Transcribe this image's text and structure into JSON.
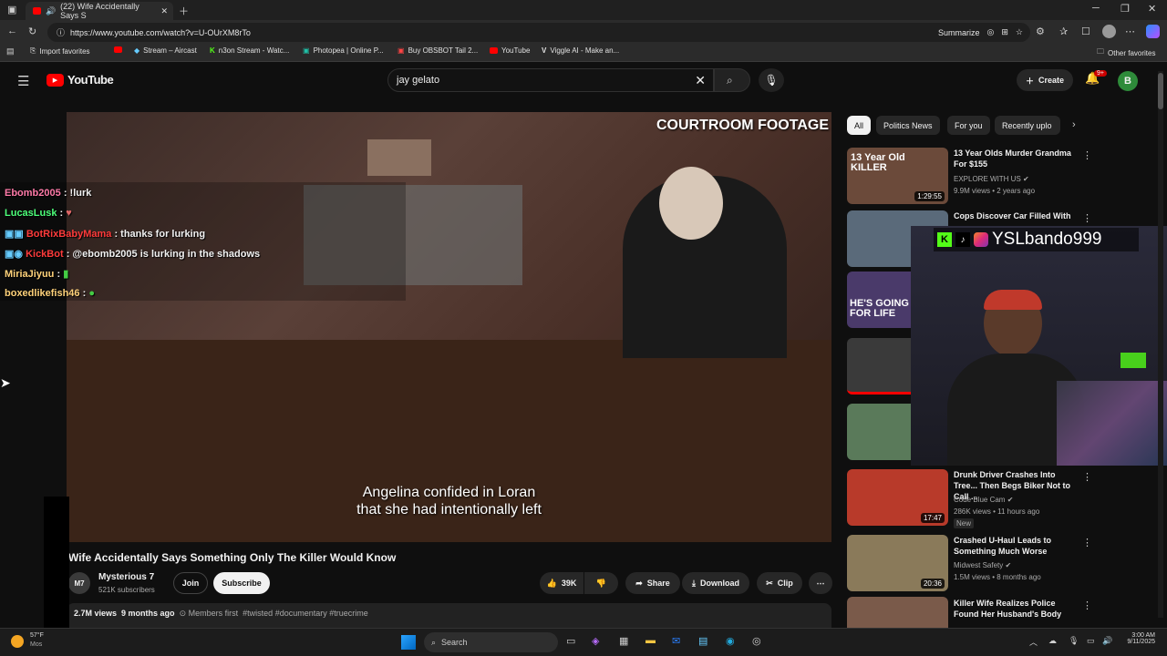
{
  "browser": {
    "tab_title": "(22) Wife Accidentally Says S",
    "url": "https://www.youtube.com/watch?v=U-OUrXM8rTo",
    "summarize_label": "Summarize",
    "bookmarks": [
      "Import favorites",
      "Stream – Aircast",
      "n3on Stream - Watc...",
      "Photopea | Online P...",
      "Buy OBSBOT Tail 2...",
      "YouTube",
      "Viggle AI - Make an..."
    ],
    "other_favorites": "Other favorites"
  },
  "youtube": {
    "logo_text": "YouTube",
    "search_value": "jay gelato",
    "create_label": "Create",
    "notif_count": "9+",
    "avatar_letter": "B"
  },
  "video": {
    "overlay_title": "COURTROOM FOOTAGE",
    "caption_line1": "Angelina confided in Loran",
    "caption_line2": "that she had intentionally left",
    "title": "Wife Accidentally Says Something Only The Killer Would Know",
    "channel": "Mysterious 7",
    "channel_avatar_text": "M7",
    "subscribers": "521K subscribers",
    "join_label": "Join",
    "subscribe_label": "Subscribe",
    "likes": "39K",
    "share_label": "Share",
    "download_label": "Download",
    "clip_label": "Clip",
    "views": "2.7M views",
    "age": "9 months ago",
    "members": "Members first",
    "tags": "#twisted #documentary #truecrime"
  },
  "chat": [
    {
      "user": "Ebomb2005",
      "msg": ": !lurk",
      "color": "#ff7aa8"
    },
    {
      "user": "LucasLusk",
      "msg": ":",
      "color": "#4dff7a"
    },
    {
      "user": "BotRixBabyMama",
      "msg": ": thanks for lurking",
      "color": "#ff3b3b"
    },
    {
      "user": "KickBot",
      "msg": ": @ebomb2005 is lurking in the shadows",
      "color": "#ff3b3b"
    },
    {
      "user": "MiriaJiyuu",
      "msg": ":",
      "color": "#ffd27a"
    },
    {
      "user": "boxedlikefish46",
      "msg": ":",
      "color": "#ffd27a"
    }
  ],
  "chips": [
    "All",
    "Politics News",
    "For you",
    "Recently uplo"
  ],
  "recs": [
    {
      "title": "13 Year Olds Murder Grandma For $155",
      "channel": "EXPLORE WITH US",
      "meta": "9.9M views • 2 years ago",
      "dur": "1:29:55",
      "thumb_text": "13 Year Old KILLER",
      "color": "#6b4a3a"
    },
    {
      "title": "Cops Discover Car Filled With",
      "channel": "",
      "meta": "",
      "dur": "",
      "thumb_text": "",
      "color": "#5a6a7a"
    },
    {
      "title": "",
      "channel": "",
      "meta": "",
      "dur": "",
      "thumb_text": "HE'S GOING FOR LIFE",
      "color": "#4a3a6a"
    },
    {
      "title": "",
      "channel": "",
      "meta": "",
      "dur": "",
      "thumb_text": "",
      "color": "#3a3a3a"
    },
    {
      "title": "",
      "channel": "",
      "meta": "",
      "dur": "",
      "thumb_text": "",
      "color": "#5a7a5a"
    },
    {
      "title": "Drunk Driver Crashes Into Tree... Then Begs Biker Not to Call ...",
      "channel": "Code Blue Cam",
      "meta": "286K views • 11 hours ago",
      "badge": "New",
      "dur": "17:47",
      "thumb_text": "",
      "color": "#b83a2a"
    },
    {
      "title": "Crashed U-Haul Leads to Something Much Worse",
      "channel": "Midwest Safety",
      "meta": "1.5M views • 8 months ago",
      "dur": "20:36",
      "thumb_text": "",
      "color": "#8a7a5a"
    },
    {
      "title": "Killer Wife Realizes Police Found Her Husband's Body",
      "channel": "",
      "meta": "",
      "dur": "",
      "thumb_text": "",
      "color": "#7a5a4a"
    }
  ],
  "stream": {
    "handle": "YSLbando999"
  },
  "taskbar": {
    "weather": "57°F",
    "weather_sub": "Mos",
    "search_label": "Search",
    "time": "3:00 AM",
    "date": "9/11/2025"
  }
}
